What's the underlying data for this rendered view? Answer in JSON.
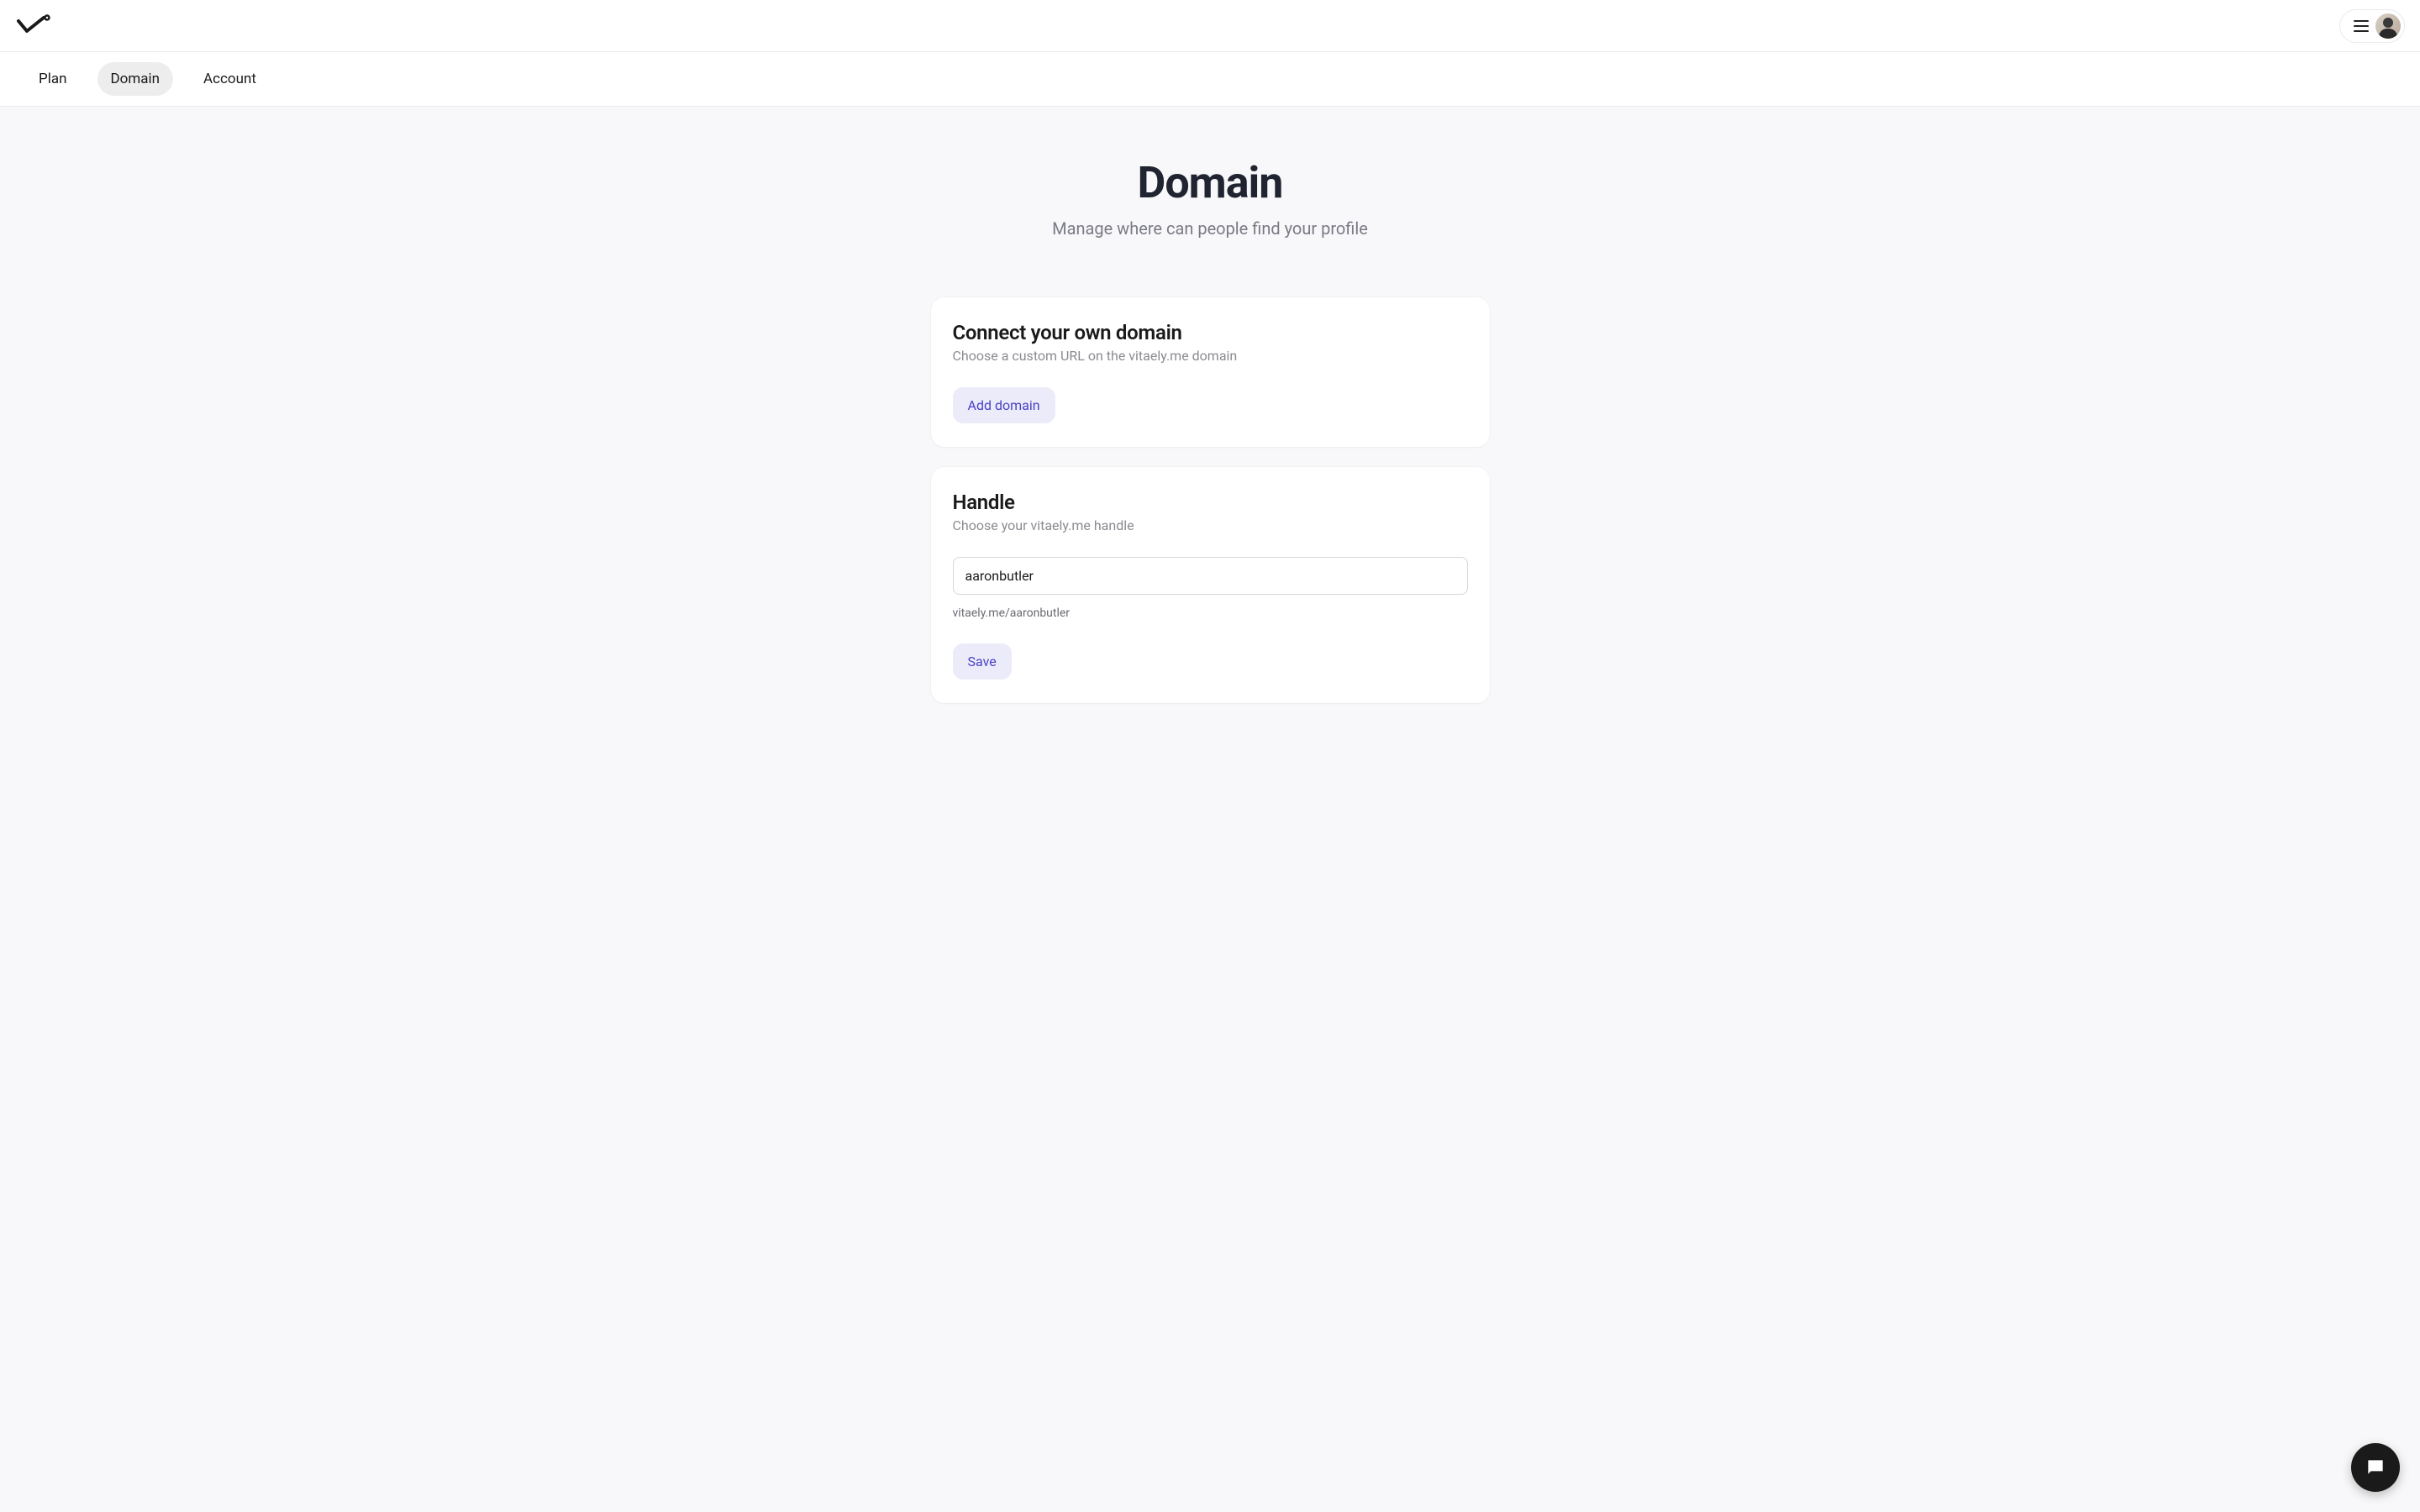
{
  "tabs": {
    "plan": "Plan",
    "domain": "Domain",
    "account": "Account",
    "active": "domain"
  },
  "page": {
    "title": "Domain",
    "subtitle": "Manage where can people find your profile"
  },
  "connect_card": {
    "title": "Connect your own domain",
    "subtitle": "Choose a custom URL on the vitaely.me domain",
    "button": "Add domain"
  },
  "handle_card": {
    "title": "Handle",
    "subtitle": "Choose your vitaely.me handle",
    "input_value": "aaronbutler",
    "helper": "vitaely.me/aaronbutler",
    "button": "Save"
  }
}
